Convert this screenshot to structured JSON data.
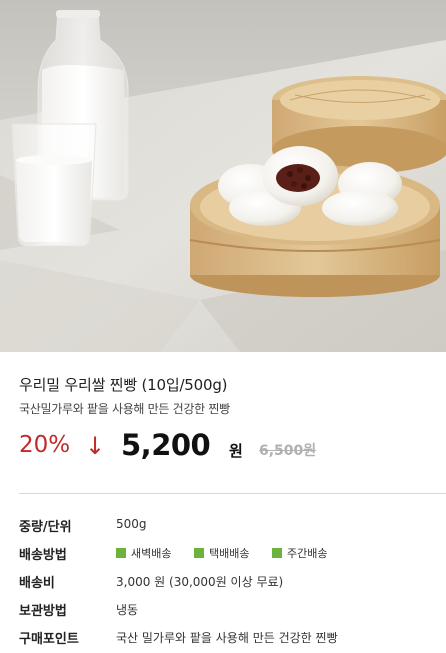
{
  "product": {
    "title": "우리밀 우리쌀 찐빵 (10입/500g)",
    "subtitle": "국산밀가루와 팥을 사용해 만든 건강한 찐빵",
    "discount": "20%",
    "arrow": "↓",
    "price": "5,200",
    "price_unit": "원",
    "original_price": "6,500원"
  },
  "details": {
    "weight_label": "중량/단위",
    "weight_value": "500g",
    "shipping_label": "배송방법",
    "shipping_options": [
      "새벽배송",
      "택배배송",
      "주간배송"
    ],
    "fee_label": "배송비",
    "fee_value": "3,000 원 (30,000원 이상 무료)",
    "storage_label": "보관방법",
    "storage_value": "냉동",
    "point_label": "구매포인트",
    "point_value": "국산 밀가루와 팥을 사용해 만든 건강한 찐빵"
  },
  "colors": {
    "discount": "#c22a2a",
    "option_square": "#6bb33c",
    "background": "#ffffff"
  },
  "icons": [
    "down-arrow-icon",
    "check-square-icon"
  ]
}
